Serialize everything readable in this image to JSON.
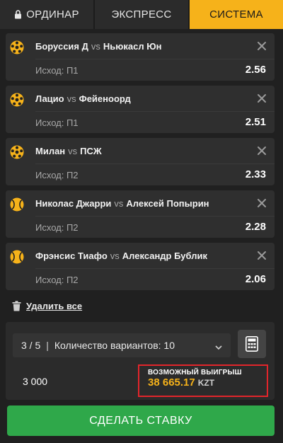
{
  "tabs": [
    {
      "label": "ОРДИНАР",
      "icon": "lock-icon"
    },
    {
      "label": "ЭКСПРЕСС"
    },
    {
      "label": "СИСТЕМА",
      "active": true
    }
  ],
  "bets": [
    {
      "team1": "Боруссия Д",
      "vs": "vs",
      "team2": "Ньюкасл Юн",
      "outcome": "Исход: П1",
      "odds": "2.56",
      "sport_icon": "soccer-ball-icon"
    },
    {
      "team1": "Лацио",
      "vs": "vs",
      "team2": "Фейеноорд",
      "outcome": "Исход: П1",
      "odds": "2.51",
      "sport_icon": "soccer-ball-icon"
    },
    {
      "team1": "Милан",
      "vs": "vs",
      "team2": "ПСЖ",
      "outcome": "Исход: П2",
      "odds": "2.33",
      "sport_icon": "soccer-ball-icon"
    },
    {
      "team1": "Николас Джарри",
      "vs": "vs",
      "team2": "Алексей Попырин",
      "outcome": "Исход: П2",
      "odds": "2.28",
      "sport_icon": "tennis-ball-icon"
    },
    {
      "team1": "Фрэнсис Тиафо",
      "vs": "vs",
      "team2": "Александр Бублик",
      "outcome": "Исход: П2",
      "odds": "2.06",
      "sport_icon": "tennis-ball-icon"
    }
  ],
  "delete_all": {
    "label": "Удалить все"
  },
  "system": {
    "combo": "3 / 5",
    "separator": "|",
    "variants_label": "Количество вариантов: 10"
  },
  "stake": {
    "value": "3 000"
  },
  "win": {
    "label": "ВОЗМОЖНЫЙ ВЫИГРЫШ",
    "value": "38 665.17",
    "currency": "KZT"
  },
  "place_bet": {
    "label": "СДЕЛАТЬ СТАВКУ"
  },
  "colors": {
    "accent": "#f6b21a",
    "button_green": "#2fa84a",
    "highlight_red": "#e2252b"
  }
}
